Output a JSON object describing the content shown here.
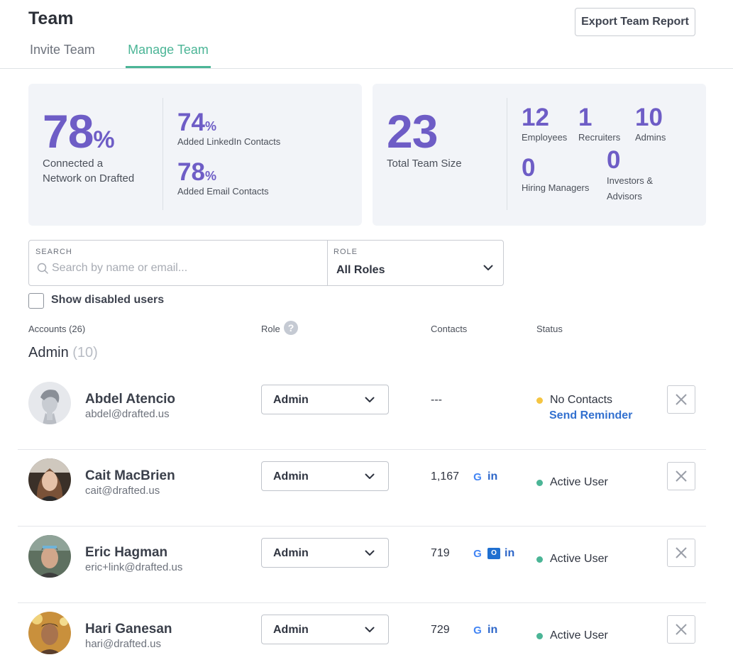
{
  "header": {
    "title": "Team",
    "export_label": "Export Team Report"
  },
  "tabs": [
    {
      "label": "Invite Team",
      "active": false
    },
    {
      "label": "Manage Team",
      "active": true
    }
  ],
  "stats_left": {
    "connected_value": "78",
    "connected_unit": "%",
    "connected_label_1": "Connected a",
    "connected_label_2": "Network on Drafted",
    "linkedin_value": "74",
    "linkedin_unit": "%",
    "linkedin_label": "Added LinkedIn Contacts",
    "email_value": "78",
    "email_unit": "%",
    "email_label": "Added Email Contacts"
  },
  "stats_right": {
    "team_size_value": "23",
    "team_size_label": "Total Team Size",
    "employees_value": "12",
    "employees_label": "Employees",
    "recruiters_value": "1",
    "recruiters_label": "Recruiters",
    "admins_value": "10",
    "admins_label": "Admins",
    "hiring_value": "0",
    "hiring_label": "Hiring Managers",
    "investors_value": "0",
    "investors_label_1": "Investors &",
    "investors_label_2": "Advisors"
  },
  "filters": {
    "search_label": "SEARCH",
    "search_placeholder": "Search by name or email...",
    "role_label": "ROLE",
    "role_value": "All Roles",
    "show_disabled_label": "Show disabled users",
    "show_disabled_checked": false
  },
  "columns": {
    "accounts": "Accounts (26)",
    "role": "Role",
    "role_help": "?",
    "contacts": "Contacts",
    "status": "Status"
  },
  "section": {
    "title": "Admin",
    "count": "(10)"
  },
  "users": [
    {
      "name": "Abdel Atencio",
      "email": "abdel@drafted.us",
      "role": "Admin",
      "contacts": "---",
      "services": [],
      "status": "No Contacts",
      "status_color": "#f5c542",
      "action": "Send Reminder",
      "avatar": "default-avatar-icon"
    },
    {
      "name": "Cait MacBrien",
      "email": "cait@drafted.us",
      "role": "Admin",
      "contacts": "1,167",
      "services": [
        "google-icon",
        "linkedin-icon"
      ],
      "status": "Active User",
      "status_color": "#4bb596",
      "avatar": "photo"
    },
    {
      "name": "Eric Hagman",
      "email": "eric+link@drafted.us",
      "role": "Admin",
      "contacts": "719",
      "services": [
        "google-icon",
        "outlook-icon",
        "linkedin-icon"
      ],
      "status": "Active User",
      "status_color": "#4bb596",
      "avatar": "photo"
    },
    {
      "name": "Hari Ganesan",
      "email": "hari@drafted.us",
      "role": "Admin",
      "contacts": "729",
      "services": [
        "google-icon",
        "linkedin-icon"
      ],
      "status": "Active User",
      "status_color": "#4bb596",
      "avatar": "photo"
    }
  ],
  "icons": {
    "google": "G",
    "linkedin": "in",
    "outlook": "O"
  },
  "colors": {
    "accent_green": "#4bb596",
    "stat_purple": "#6e5dc6",
    "link_blue": "#3270cf",
    "card_bg": "#f2f4f8"
  }
}
